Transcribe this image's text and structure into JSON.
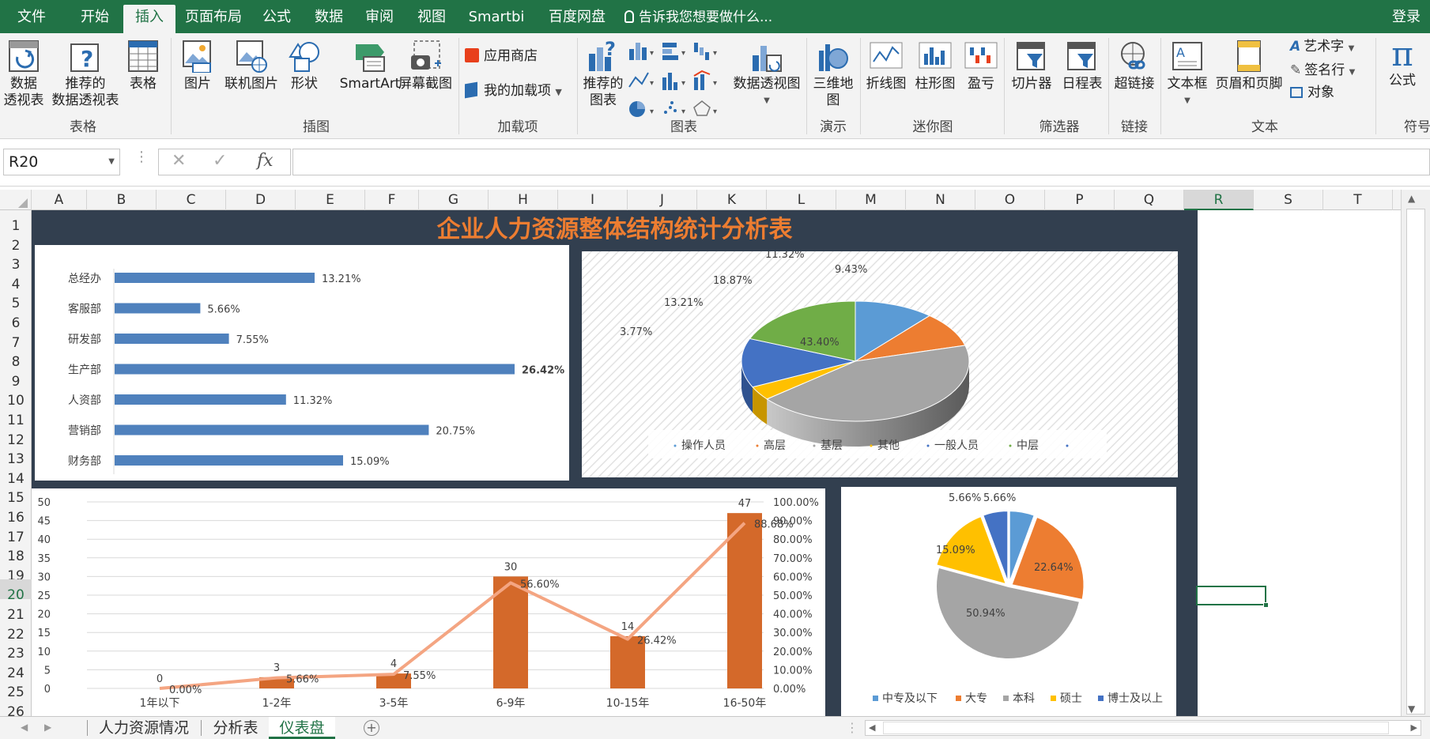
{
  "tabs": [
    {
      "label": "文件"
    },
    {
      "label": "开始"
    },
    {
      "label": "插入"
    },
    {
      "label": "页面布局"
    },
    {
      "label": "公式"
    },
    {
      "label": "数据"
    },
    {
      "label": "审阅"
    },
    {
      "label": "视图"
    },
    {
      "label": "Smartbi"
    },
    {
      "label": "百度网盘"
    }
  ],
  "tell_me": "告诉我您想要做什么...",
  "login": "登录",
  "ribbon": {
    "pivot": "数据\n透视表",
    "rec_pivot": "推荐的\n数据透视表",
    "table": "表格",
    "g_table": "表格",
    "picture": "图片",
    "online_pic": "联机图片",
    "shapes": "形状",
    "smartart": "SmartArt",
    "screenshot": "屏幕截图",
    "g_illus": "插图",
    "store": "应用商店",
    "myaddins": "我的加载项",
    "g_addins": "加载项",
    "rec_charts": "推荐的\n图表",
    "pivotchart": "数据透视图",
    "g_charts": "图表",
    "map3d": "三维地\n图",
    "g_tours": "演示",
    "sp_line": "折线图",
    "sp_col": "柱形图",
    "sp_wl": "盈亏",
    "g_spark": "迷你图",
    "slicer": "切片器",
    "timeline": "日程表",
    "g_filter": "筛选器",
    "hyperlink": "超链接",
    "g_links": "链接",
    "textbox": "文本框",
    "header": "页眉和页脚",
    "wordart": "艺术字",
    "sigline": "签名行",
    "object": "对象",
    "g_text": "文本",
    "equation": "公式",
    "g_symbols": "符号"
  },
  "namebox": "R20",
  "columns": [
    "A",
    "B",
    "C",
    "D",
    "E",
    "F",
    "G",
    "H",
    "I",
    "J",
    "K",
    "L",
    "M",
    "N",
    "O",
    "P",
    "Q",
    "R",
    "S",
    "T"
  ],
  "rows": [
    "1",
    "2",
    "3",
    "4",
    "5",
    "6",
    "7",
    "8",
    "9",
    "10",
    "11",
    "12",
    "13",
    "14",
    "15",
    "16",
    "17",
    "18",
    "19",
    "20",
    "21",
    "22",
    "23",
    "24",
    "25",
    "26"
  ],
  "dashboard_title": "企业人力资源整体结构统计分析表",
  "sheets": [
    {
      "label": "人力资源情况"
    },
    {
      "label": "分析表"
    },
    {
      "label": "仪表盘"
    }
  ],
  "chart_data": [
    {
      "type": "bar",
      "categories": [
        "总经办",
        "客服部",
        "研发部",
        "生产部",
        "人资部",
        "营销部",
        "财务部"
      ],
      "values": [
        13.21,
        5.66,
        7.55,
        26.42,
        11.32,
        20.75,
        15.09
      ],
      "labels": [
        "13.21%",
        "5.66%",
        "7.55%",
        "26.42%",
        "11.32%",
        "20.75%",
        "15.09%"
      ],
      "color": "#4f81bd"
    },
    {
      "type": "pie",
      "slices": [
        {
          "name": "操作人员",
          "value": 11.32,
          "label": "11.32%",
          "color": "#5b9bd5"
        },
        {
          "name": "高层",
          "value": 9.43,
          "label": "9.43%",
          "color": "#ed7d31"
        },
        {
          "name": "基层",
          "value": 43.4,
          "label": "43.40%",
          "color": "#a5a5a5"
        },
        {
          "name": "其他",
          "value": 3.77,
          "label": "3.77%",
          "color": "#ffc000"
        },
        {
          "name": "一般人员",
          "value": 13.21,
          "label": "13.21%",
          "color": "#4472c4"
        },
        {
          "name": "中层",
          "value": 18.87,
          "label": "18.87%",
          "color": "#70ad47"
        }
      ],
      "legend": [
        "操作人员",
        "高层",
        "基层",
        "其他",
        "一般人员",
        "中层"
      ]
    },
    {
      "type": "bar+line",
      "categories": [
        "1年以下",
        "1-2年",
        "3-5年",
        "6-9年",
        "10-15年",
        "16-50年"
      ],
      "bar_values": [
        0,
        3,
        4,
        30,
        14,
        47
      ],
      "line_values": [
        0.0,
        5.66,
        7.55,
        56.6,
        26.42,
        88.68
      ],
      "line_labels": [
        "0.00%",
        "5.66%",
        "7.55%",
        "56.60%",
        "26.42%",
        "88.68%"
      ],
      "ylim": [
        0,
        50
      ],
      "yticks": [
        "0",
        "5",
        "10",
        "15",
        "20",
        "25",
        "30",
        "35",
        "40",
        "45",
        "50"
      ],
      "y2lim": [
        0,
        100
      ],
      "y2ticks": [
        "0.00%",
        "10.00%",
        "20.00%",
        "30.00%",
        "40.00%",
        "50.00%",
        "60.00%",
        "70.00%",
        "80.00%",
        "90.00%",
        "100.00%"
      ],
      "bar_color": "#d4692a",
      "line_color": "#f4a582"
    },
    {
      "type": "pie",
      "slices": [
        {
          "name": "中专及以下",
          "value": 5.66,
          "label": "5.66%",
          "color": "#5b9bd5"
        },
        {
          "name": "大专",
          "value": 22.64,
          "label": "22.64%",
          "color": "#ed7d31"
        },
        {
          "name": "本科",
          "value": 50.94,
          "label": "50.94%",
          "color": "#a5a5a5"
        },
        {
          "name": "硕士",
          "value": 15.09,
          "label": "15.09%",
          "color": "#ffc000"
        },
        {
          "name": "博士及以上",
          "value": 5.66,
          "label": "5.66%",
          "color": "#4472c4"
        }
      ],
      "legend": [
        "中专及以下",
        "大专",
        "本科",
        "硕士",
        "博士及以上"
      ]
    }
  ]
}
